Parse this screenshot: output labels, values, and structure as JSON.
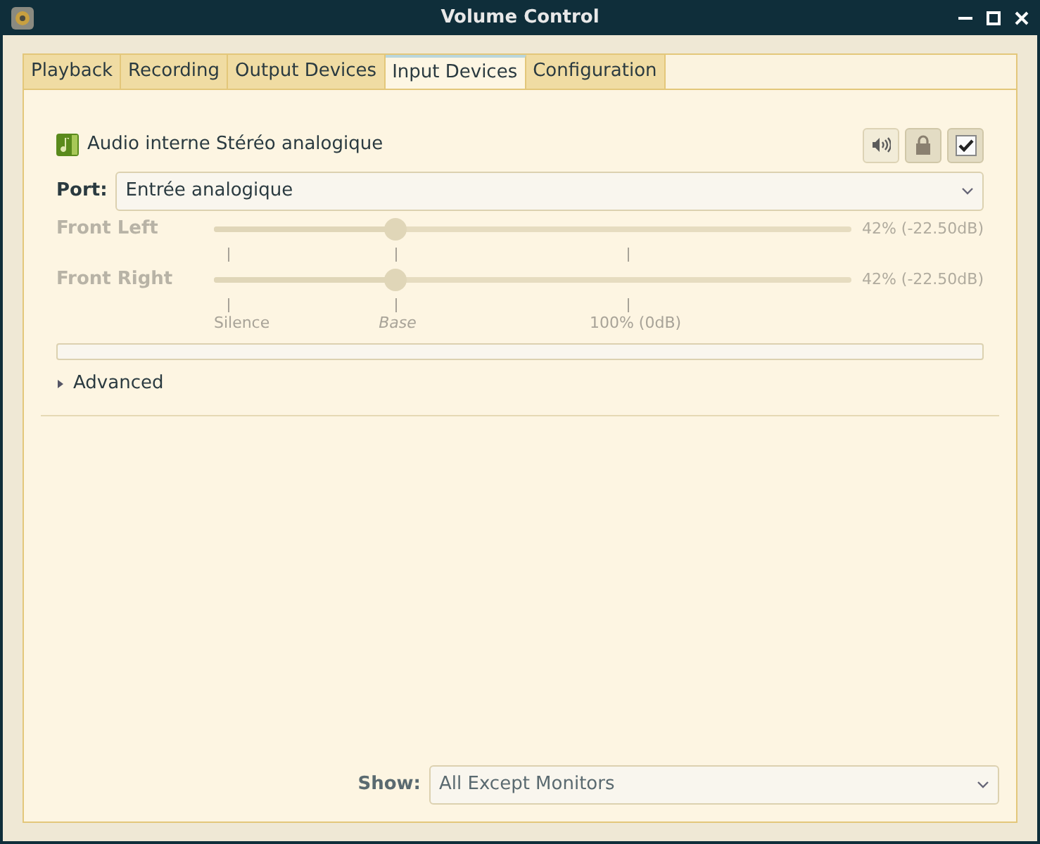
{
  "window": {
    "title": "Volume Control"
  },
  "tabs": [
    {
      "label": "Playback",
      "selected": false
    },
    {
      "label": "Recording",
      "selected": false
    },
    {
      "label": "Output Devices",
      "selected": false
    },
    {
      "label": "Input Devices",
      "selected": true
    },
    {
      "label": "Configuration",
      "selected": false
    }
  ],
  "device": {
    "name": "Audio interne Stéréo analogique",
    "toggles": [
      {
        "kind": "mute",
        "on": false
      },
      {
        "kind": "lock",
        "on": true
      },
      {
        "kind": "default",
        "on": true
      }
    ],
    "port": {
      "label": "Port:",
      "value": "Entrée analogique"
    },
    "channels": [
      {
        "name": "Front Left",
        "disabled": true,
        "level": 0.285,
        "reading": "42% (-22.50dB)"
      },
      {
        "name": "Front Right",
        "disabled": true,
        "level": 0.285,
        "reading": "42% (-22.50dB)"
      }
    ],
    "scale_marks": [
      {
        "label": "Silence",
        "italic": false
      },
      {
        "label": "Base",
        "italic": true
      },
      {
        "label": "100% (0dB)",
        "italic": false
      }
    ],
    "meter": {
      "level": 0
    },
    "advanced": {
      "label": "Advanced",
      "expanded": false
    }
  },
  "show": {
    "label": "Show:",
    "value": "All Except Monitors"
  }
}
